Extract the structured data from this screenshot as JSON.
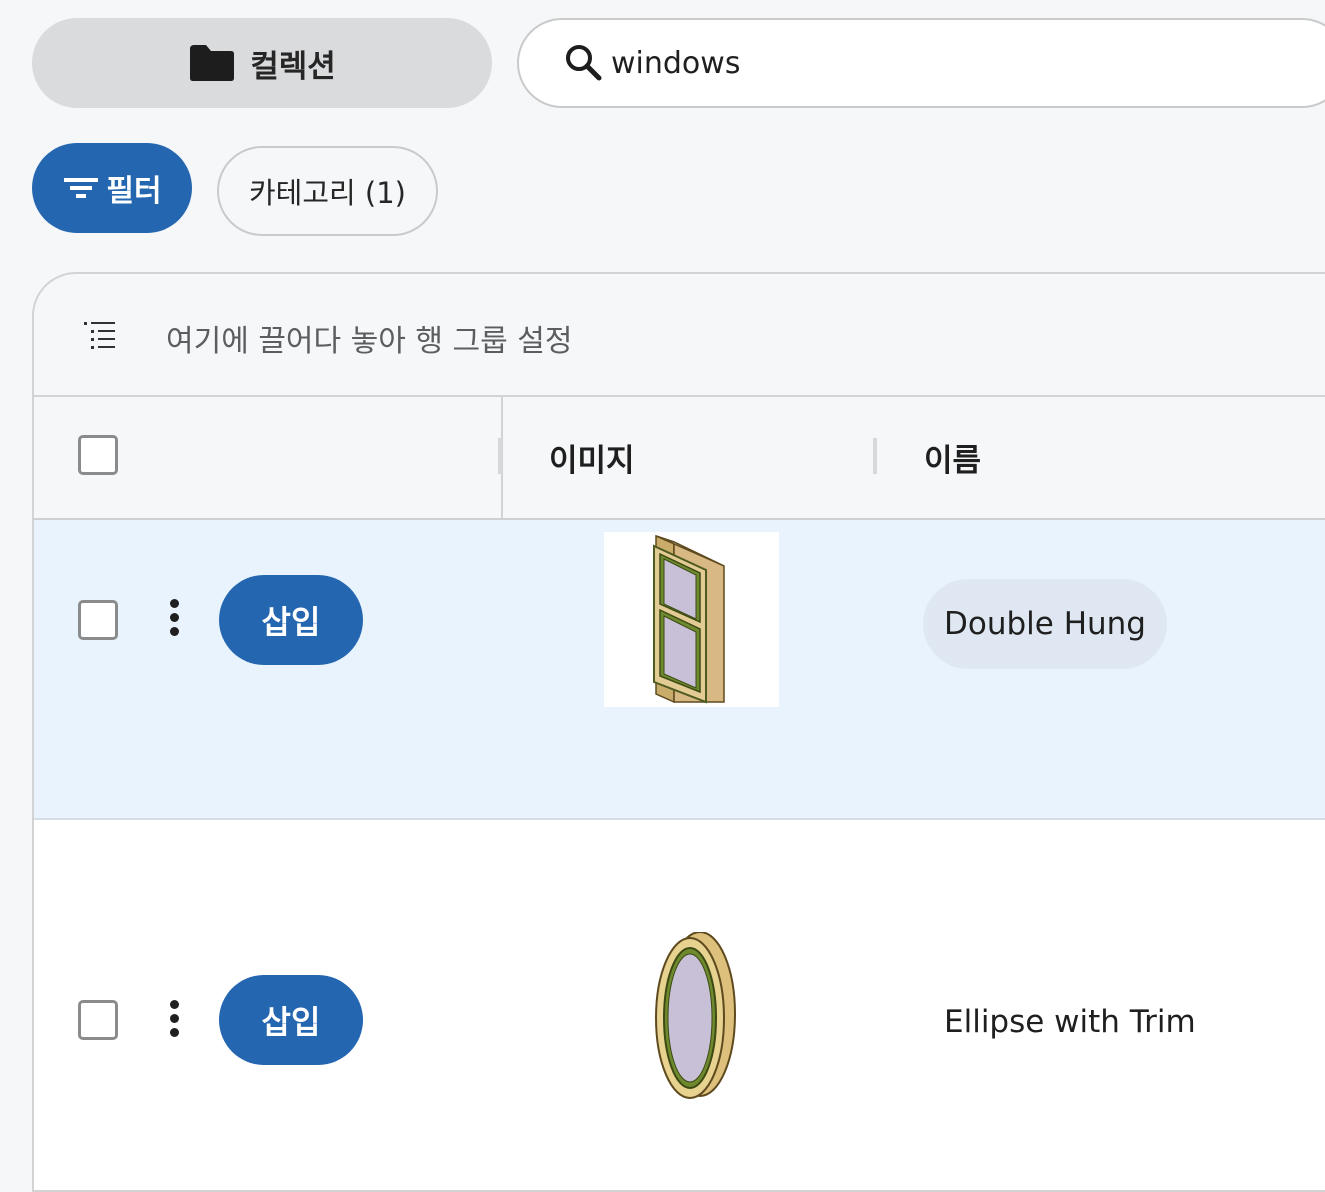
{
  "toolbar": {
    "collections_label": "컬렉션",
    "search_value": "windows",
    "filter_label": "필터",
    "category_chip_label": "카테고리 (1)"
  },
  "grid": {
    "group_bar_text": "여기에 끌어다 놓아 행 그룹 설정",
    "columns": [
      "이미지",
      "이름"
    ],
    "rows": [
      {
        "insert_label": "삽입",
        "name": "Double Hung",
        "selected": true
      },
      {
        "insert_label": "삽입",
        "name": "Ellipse with Trim",
        "selected": false
      }
    ]
  },
  "colors": {
    "accent": "#2566b0",
    "selected_row": "#e8f3fd",
    "background": "#f6f7f8"
  },
  "icons": [
    "folder-icon",
    "search-icon",
    "filter-icon",
    "row-group-icon",
    "kebab-menu-icon"
  ]
}
